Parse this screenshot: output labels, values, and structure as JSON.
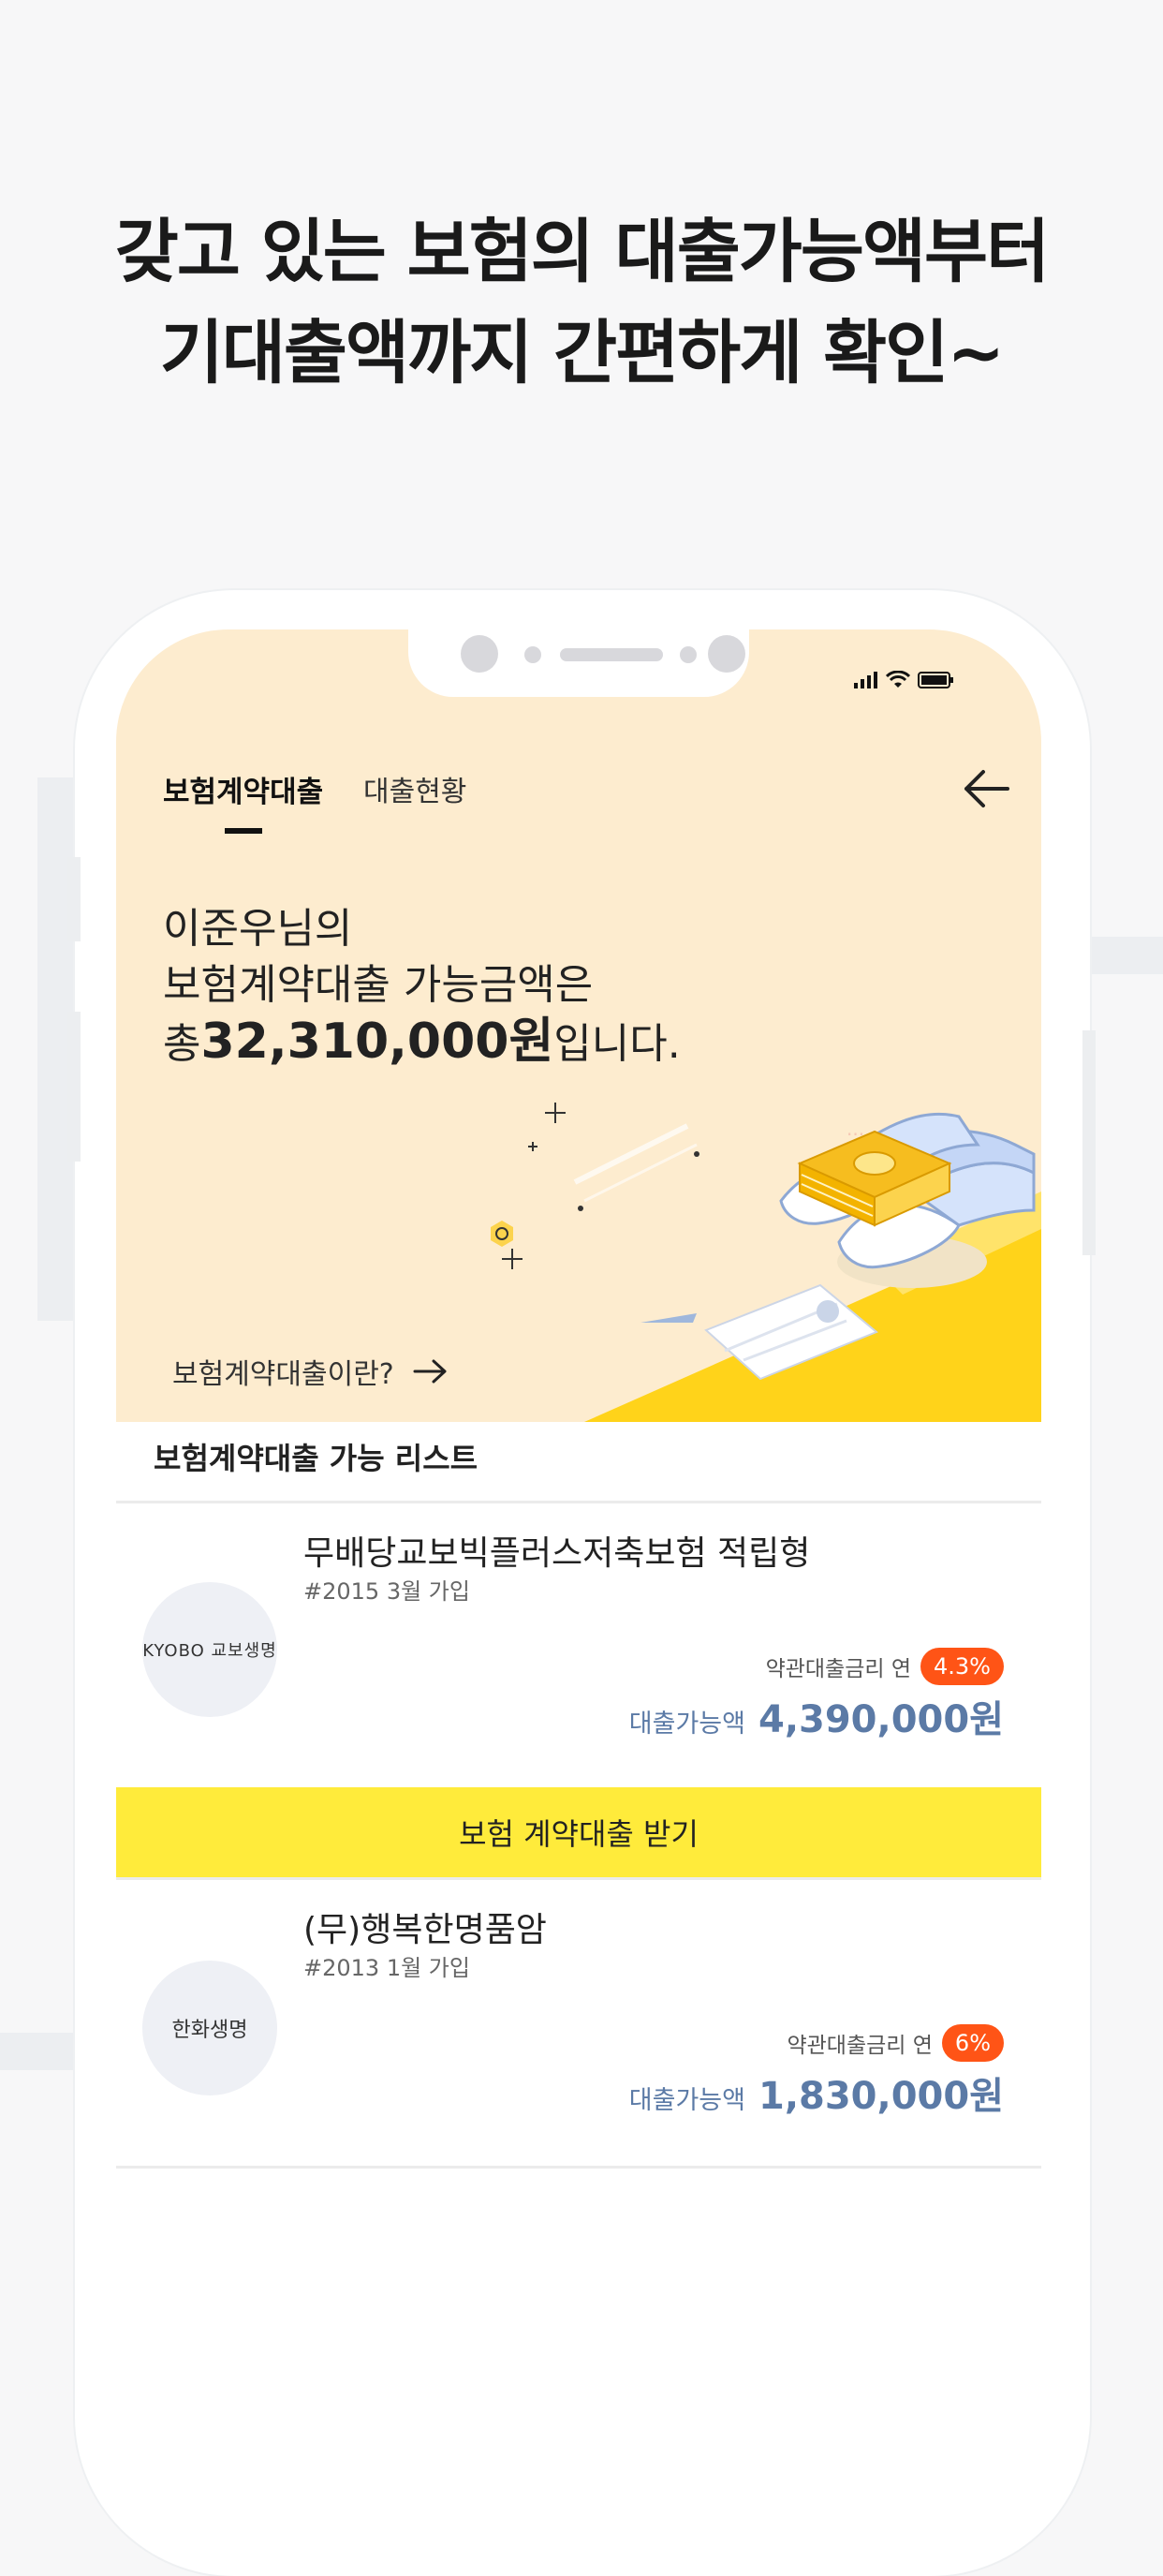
{
  "headline": {
    "line1": "갖고 있는 보험의 대출가능액부터",
    "line2": "기대출액까지 간편하게 확인~"
  },
  "tabs": {
    "active": "보험계약대출",
    "inactive": "대출현황"
  },
  "hero": {
    "line1": "이준우님의",
    "line2": "보험계약대출 가능금액은",
    "prefix": "총",
    "amount": "32,310,000원",
    "suffix": "입니다.",
    "link_label": "보험계약대출이란?"
  },
  "list": {
    "title": "보험계약대출 가능 리스트",
    "items": [
      {
        "company_logo": "KYOBO 교보생명",
        "name": "무배당교보빅플러스저축보험 적립형",
        "joined": "#2015 3월 가입",
        "rate_label": "약관대출금리 연",
        "rate": "4.3%",
        "amount_label": "대출가능액",
        "amount": "4,390,000원"
      },
      {
        "company_logo": "한화생명",
        "name": "(무)행복한명품암",
        "joined": "#2013 1월 가입",
        "rate_label": "약관대출금리 연",
        "rate": "6%",
        "amount_label": "대출가능액",
        "amount": "1,830,000원"
      }
    ]
  },
  "cta": {
    "label": "보험 계약대출 받기"
  },
  "icons": [
    "back-arrow-icon",
    "right-arrow-icon",
    "signal-icon",
    "wifi-icon",
    "battery-icon"
  ],
  "colors": {
    "hero_bg": "#fdeccf",
    "accent_yellow": "#ffeb3b",
    "rate_badge": "#ff5416",
    "amount_blue": "#5b7aa6"
  }
}
